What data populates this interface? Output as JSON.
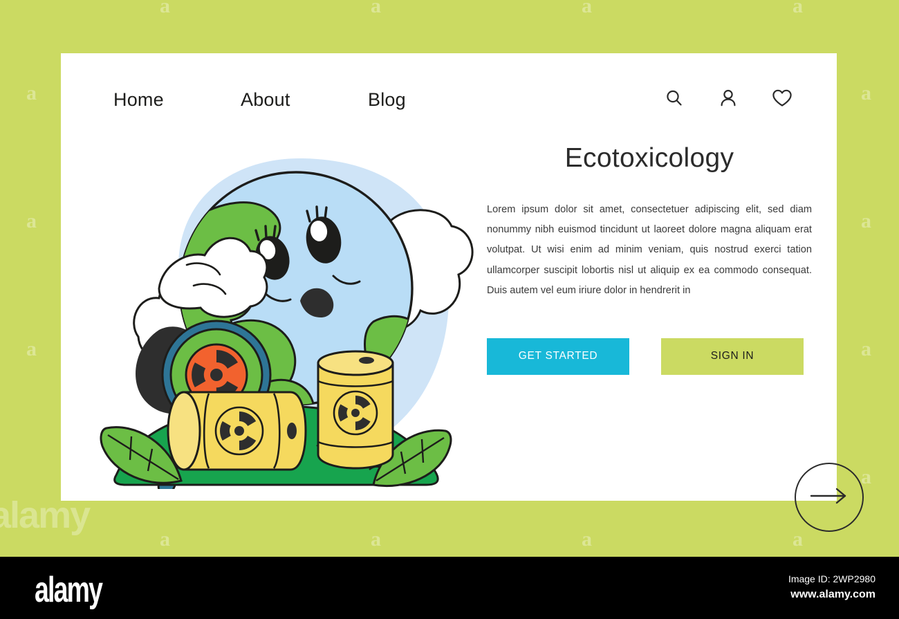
{
  "page": {
    "background_color": "#cbda62",
    "card_background": "#ffffff"
  },
  "nav": {
    "links": [
      {
        "label": "Home",
        "name": "nav-link-home"
      },
      {
        "label": "About",
        "name": "nav-link-about"
      },
      {
        "label": "Blog",
        "name": "nav-link-blog"
      }
    ],
    "icons": [
      {
        "name": "search-icon",
        "label": "Search"
      },
      {
        "name": "user-icon",
        "label": "Account"
      },
      {
        "name": "heart-icon",
        "label": "Favorites"
      }
    ]
  },
  "hero": {
    "title": "Ecotoxicology",
    "body": "Lorem ipsum dolor sit amet, consectetuer adipiscing elit, sed diam nonummy nibh euismod tincidunt ut laoreet dolore magna aliquam erat volutpat. Ut wisi enim ad minim veniam, quis nostrud exerci tation ullamcorper suscipit lobortis nisl ut aliquip ex ea commodo consequat. Duis autem vel eum iriure dolor in hendrerit in",
    "primary_button": "GET STARTED",
    "secondary_button": "SIGN IN",
    "primary_color": "#18b8d8",
    "secondary_color": "#cbda62",
    "next_button_icon": "arrow-right-icon"
  },
  "illustration": {
    "name": "earth-ecotoxicology-illustration",
    "description": "Sad cartoon Earth with magnifying glass revealing radiation symbol, yellow toxic waste barrels on green ground with leaves",
    "colors": {
      "backdrop_blue": "#cfe4f7",
      "ocean": "#b9ddf6",
      "land_green": "#6cbe45",
      "ground_green": "#17a44e",
      "leaf_green": "#6cbe45",
      "barrel_yellow": "#f5d95e",
      "radiation_orange": "#f2622e",
      "magnifier_teal": "#2e7596",
      "outline": "#1d1d1b",
      "cloud_white": "#ffffff"
    }
  },
  "watermark": {
    "letter": "a",
    "wordmark": "alamy"
  },
  "footer": {
    "logo": "alamy",
    "image_id": "Image ID: 2WP2980",
    "url": "www.alamy.com",
    "background": "#000000"
  }
}
